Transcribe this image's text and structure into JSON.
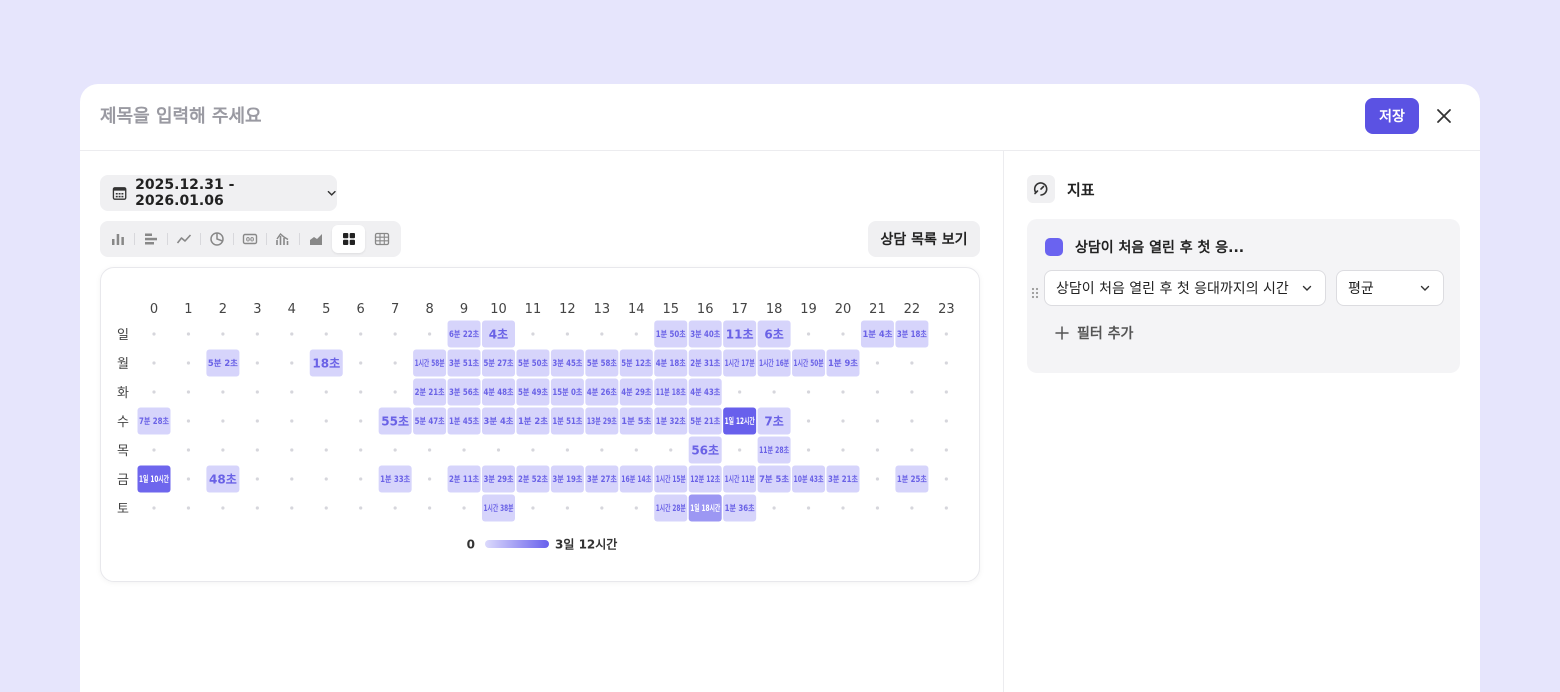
{
  "header": {
    "title_placeholder": "제목을 입력해 주세요",
    "save_label": "저장"
  },
  "toolbar": {
    "date_range": "2025.12.31 - 2026.01.06",
    "list_button": "상담 목록 보기",
    "chart_types": [
      {
        "icon": "bar-chart-icon",
        "active": false
      },
      {
        "icon": "horizontal-bar-chart-icon",
        "active": false
      },
      {
        "icon": "line-chart-icon",
        "active": false
      },
      {
        "icon": "pie-chart-icon",
        "active": false
      },
      {
        "icon": "number-card-icon",
        "active": false
      },
      {
        "icon": "funnel-chart-icon",
        "active": false
      },
      {
        "icon": "area-chart-icon",
        "active": false
      },
      {
        "icon": "heatmap-icon",
        "active": true
      },
      {
        "icon": "table-icon",
        "active": false
      }
    ]
  },
  "metric_panel": {
    "heading": "지표",
    "metric_title": "상담이 처음 열린 후 첫 응...",
    "metric_select": "상담이 처음 열린 후 첫 응대까지의 시간",
    "agg_select": "평균",
    "add_filter": "필터 추가",
    "metric_color": "#6a63f0"
  },
  "chart_data": {
    "type": "heatmap",
    "x": [
      "0",
      "1",
      "2",
      "3",
      "4",
      "5",
      "6",
      "7",
      "8",
      "9",
      "10",
      "11",
      "12",
      "13",
      "14",
      "15",
      "16",
      "17",
      "18",
      "19",
      "20",
      "21",
      "22",
      "23"
    ],
    "y": [
      "일",
      "월",
      "화",
      "수",
      "목",
      "금",
      "토"
    ],
    "legend_min": "0",
    "legend_max": "3일 12시간",
    "cells": [
      {
        "row": 0,
        "col": 9,
        "label": "6분 22초",
        "level": 0.12
      },
      {
        "row": 0,
        "col": 10,
        "label": "4초",
        "level": 0.1
      },
      {
        "row": 0,
        "col": 15,
        "label": "1분 50초",
        "level": 0.1
      },
      {
        "row": 0,
        "col": 16,
        "label": "3분 40초",
        "level": 0.12
      },
      {
        "row": 0,
        "col": 17,
        "label": "11초",
        "level": 0.1
      },
      {
        "row": 0,
        "col": 18,
        "label": "6초",
        "level": 0.1
      },
      {
        "row": 0,
        "col": 21,
        "label": "1분 4초",
        "level": 0.1
      },
      {
        "row": 0,
        "col": 22,
        "label": "3분 18초",
        "level": 0.12
      },
      {
        "row": 1,
        "col": 2,
        "label": "5분 2초",
        "level": 0.12
      },
      {
        "row": 1,
        "col": 5,
        "label": "18초",
        "level": 0.1
      },
      {
        "row": 1,
        "col": 8,
        "label": "1시간 58분",
        "level": 0.14
      },
      {
        "row": 1,
        "col": 9,
        "label": "3분 51초",
        "level": 0.12
      },
      {
        "row": 1,
        "col": 10,
        "label": "5분 27초",
        "level": 0.12
      },
      {
        "row": 1,
        "col": 11,
        "label": "5분 50초",
        "level": 0.12
      },
      {
        "row": 1,
        "col": 12,
        "label": "3분 45초",
        "level": 0.12
      },
      {
        "row": 1,
        "col": 13,
        "label": "5분 58초",
        "level": 0.12
      },
      {
        "row": 1,
        "col": 14,
        "label": "5분 12초",
        "level": 0.12
      },
      {
        "row": 1,
        "col": 15,
        "label": "4분 18초",
        "level": 0.12
      },
      {
        "row": 1,
        "col": 16,
        "label": "2분 31초",
        "level": 0.12
      },
      {
        "row": 1,
        "col": 17,
        "label": "1시간 17분",
        "level": 0.14
      },
      {
        "row": 1,
        "col": 18,
        "label": "1시간 16분",
        "level": 0.14
      },
      {
        "row": 1,
        "col": 19,
        "label": "1시간 50분",
        "level": 0.14
      },
      {
        "row": 1,
        "col": 20,
        "label": "1분 9초",
        "level": 0.1
      },
      {
        "row": 2,
        "col": 8,
        "label": "2분 21초",
        "level": 0.12
      },
      {
        "row": 2,
        "col": 9,
        "label": "3분 56초",
        "level": 0.12
      },
      {
        "row": 2,
        "col": 10,
        "label": "4분 48초",
        "level": 0.12
      },
      {
        "row": 2,
        "col": 11,
        "label": "5분 49초",
        "level": 0.12
      },
      {
        "row": 2,
        "col": 12,
        "label": "15분 0초",
        "level": 0.12
      },
      {
        "row": 2,
        "col": 13,
        "label": "4분 26초",
        "level": 0.12
      },
      {
        "row": 2,
        "col": 14,
        "label": "4분 29초",
        "level": 0.12
      },
      {
        "row": 2,
        "col": 15,
        "label": "11분 18초",
        "level": 0.12
      },
      {
        "row": 2,
        "col": 16,
        "label": "4분 43초",
        "level": 0.12
      },
      {
        "row": 3,
        "col": 0,
        "label": "7분 28초",
        "level": 0.12
      },
      {
        "row": 3,
        "col": 7,
        "label": "55초",
        "level": 0.1
      },
      {
        "row": 3,
        "col": 8,
        "label": "5분 47초",
        "level": 0.12
      },
      {
        "row": 3,
        "col": 9,
        "label": "1분 45초",
        "level": 0.12
      },
      {
        "row": 3,
        "col": 10,
        "label": "3분 4초",
        "level": 0.12
      },
      {
        "row": 3,
        "col": 11,
        "label": "1분 2초",
        "level": 0.12
      },
      {
        "row": 3,
        "col": 12,
        "label": "1분 51초",
        "level": 0.12
      },
      {
        "row": 3,
        "col": 13,
        "label": "13분 29초",
        "level": 0.12
      },
      {
        "row": 3,
        "col": 14,
        "label": "1분 5초",
        "level": 0.12
      },
      {
        "row": 3,
        "col": 15,
        "label": "1분 32초",
        "level": 0.12
      },
      {
        "row": 3,
        "col": 16,
        "label": "5분 21초",
        "level": 0.12
      },
      {
        "row": 3,
        "col": 17,
        "label": "1일 12시간",
        "level": 1.0
      },
      {
        "row": 3,
        "col": 18,
        "label": "7초",
        "level": 0.1
      },
      {
        "row": 4,
        "col": 16,
        "label": "56초",
        "level": 0.1
      },
      {
        "row": 4,
        "col": 18,
        "label": "11분 28초",
        "level": 0.12
      },
      {
        "row": 5,
        "col": 0,
        "label": "1일 10시간",
        "level": 0.95
      },
      {
        "row": 5,
        "col": 2,
        "label": "48초",
        "level": 0.1
      },
      {
        "row": 5,
        "col": 7,
        "label": "1분 33초",
        "level": 0.12
      },
      {
        "row": 5,
        "col": 9,
        "label": "2분 11초",
        "level": 0.12
      },
      {
        "row": 5,
        "col": 10,
        "label": "3분 29초",
        "level": 0.12
      },
      {
        "row": 5,
        "col": 11,
        "label": "2분 52초",
        "level": 0.12
      },
      {
        "row": 5,
        "col": 12,
        "label": "3분 19초",
        "level": 0.12
      },
      {
        "row": 5,
        "col": 13,
        "label": "3분 27초",
        "level": 0.12
      },
      {
        "row": 5,
        "col": 14,
        "label": "16분 14초",
        "level": 0.12
      },
      {
        "row": 5,
        "col": 15,
        "label": "1시간 15분",
        "level": 0.14
      },
      {
        "row": 5,
        "col": 16,
        "label": "12분 12초",
        "level": 0.12
      },
      {
        "row": 5,
        "col": 17,
        "label": "1시간 11분",
        "level": 0.14
      },
      {
        "row": 5,
        "col": 18,
        "label": "7분 5초",
        "level": 0.12
      },
      {
        "row": 5,
        "col": 19,
        "label": "10분 43초",
        "level": 0.12
      },
      {
        "row": 5,
        "col": 20,
        "label": "3분 21초",
        "level": 0.12
      },
      {
        "row": 5,
        "col": 22,
        "label": "1분 25초",
        "level": 0.12
      },
      {
        "row": 6,
        "col": 10,
        "label": "1시간 38분",
        "level": 0.14
      },
      {
        "row": 6,
        "col": 15,
        "label": "1시간 28분",
        "level": 0.14
      },
      {
        "row": 6,
        "col": 16,
        "label": "1일 18시간",
        "level": 0.55
      },
      {
        "row": 6,
        "col": 17,
        "label": "1분 36초",
        "level": 0.12
      }
    ]
  }
}
